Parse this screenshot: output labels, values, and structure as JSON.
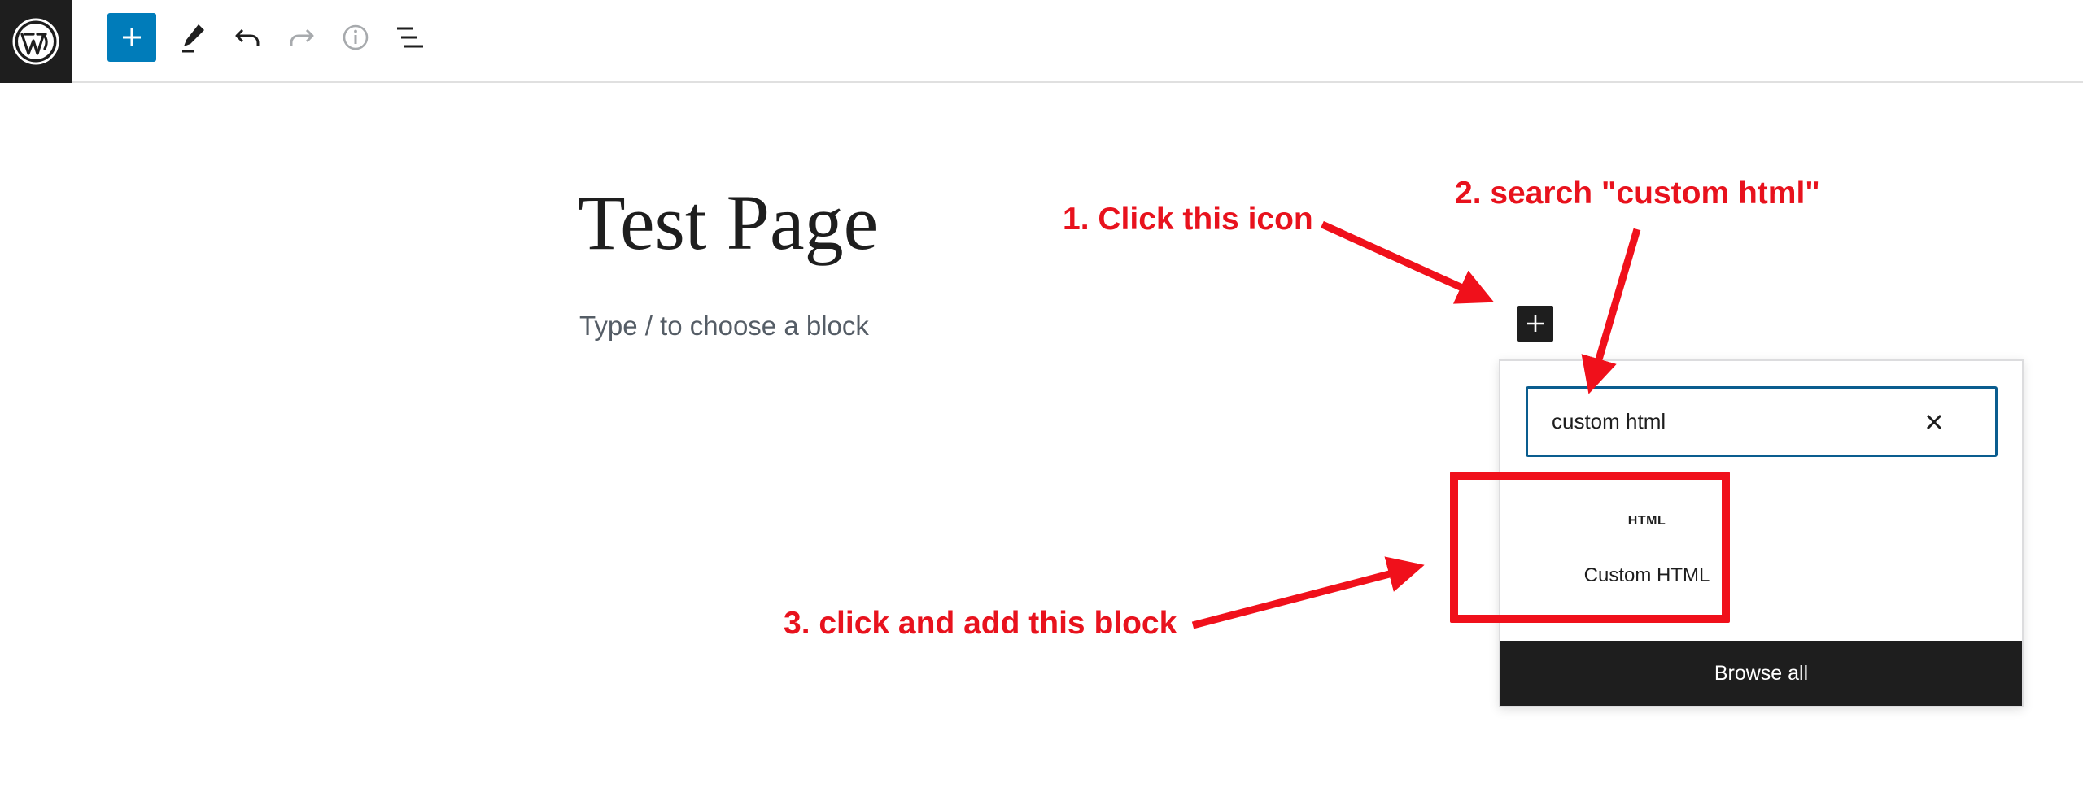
{
  "toolbar": {
    "logo_icon": "wordpress-logo-icon",
    "buttons": [
      {
        "name": "add-block-button",
        "icon": "plus-icon"
      },
      {
        "name": "tools-button",
        "icon": "pencil-icon"
      },
      {
        "name": "undo-button",
        "icon": "undo-icon"
      },
      {
        "name": "redo-button",
        "icon": "redo-icon"
      },
      {
        "name": "details-button",
        "icon": "info-icon"
      },
      {
        "name": "list-view-button",
        "icon": "list-view-icon"
      }
    ],
    "accent_color": "#007cba"
  },
  "editor": {
    "title": "Test Page",
    "block_placeholder": "Type / to choose a block"
  },
  "inserter": {
    "search_value": "custom html",
    "results": [
      {
        "icon_text": "HTML",
        "label": "Custom HTML"
      }
    ],
    "browse_all_label": "Browse all"
  },
  "annotations": {
    "step1": "1. Click this icon",
    "step2": "2. search \"custom html\"",
    "step3": "3. click and add this block",
    "color": "#e8121d"
  }
}
